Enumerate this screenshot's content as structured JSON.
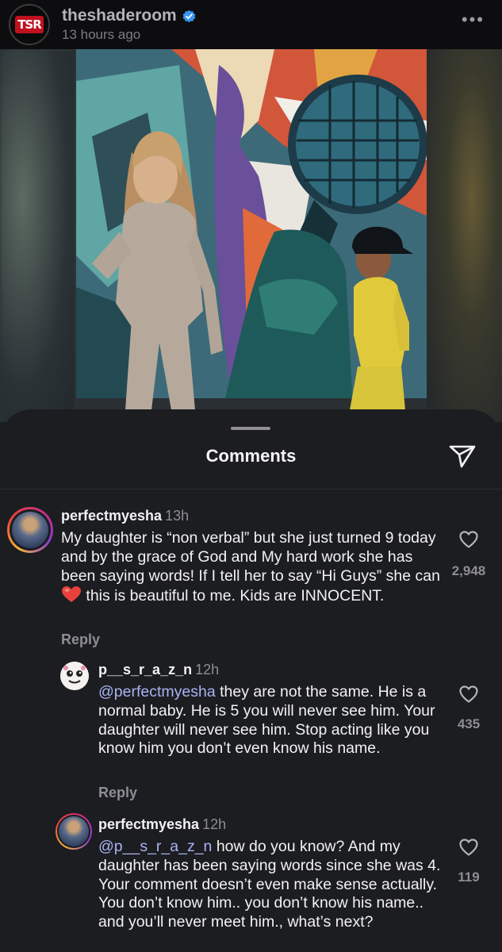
{
  "post": {
    "username": "theshaderoom",
    "logo_text": "TSR",
    "time": "13 hours ago",
    "more_label": "•••"
  },
  "sheet": {
    "title": "Comments"
  },
  "comments": [
    {
      "username": "perfectmyesha",
      "time": "13h",
      "text_parts": [
        "My daughter is “non verbal” but she just turned 9 today and by the grace of God and My hard work she has been saying words! If I tell her to say “Hi Guys” she can ",
        " this is beautiful to me. Kids are INNOCENT."
      ],
      "emoji": "red-heart",
      "reply_label": "Reply",
      "likes": "2,948"
    },
    {
      "username": "p__s_r_a_z_n",
      "time": "12h",
      "mention": "@perfectmyesha",
      "text": " they are not the same. He is a normal baby. He is 5 you will never see him. Your daughter will never see him. Stop acting like you know him you don’t even know his name.",
      "reply_label": "Reply",
      "likes": "435"
    },
    {
      "username": "perfectmyesha",
      "time": "12h",
      "mention": "@p__s_r_a_z_n",
      "text": " how do you know? And my daughter has been saying words since she was 4. Your comment doesn’t even make sense actually. You don’t know him.. you don’t know his name.. and you’ll never meet him., what’s next?",
      "likes": "119"
    }
  ],
  "colors": {
    "background": "#1c1d21",
    "mention": "#a9b3f2",
    "verified": "#3897f0",
    "emoji_heart": "#e8413b"
  }
}
